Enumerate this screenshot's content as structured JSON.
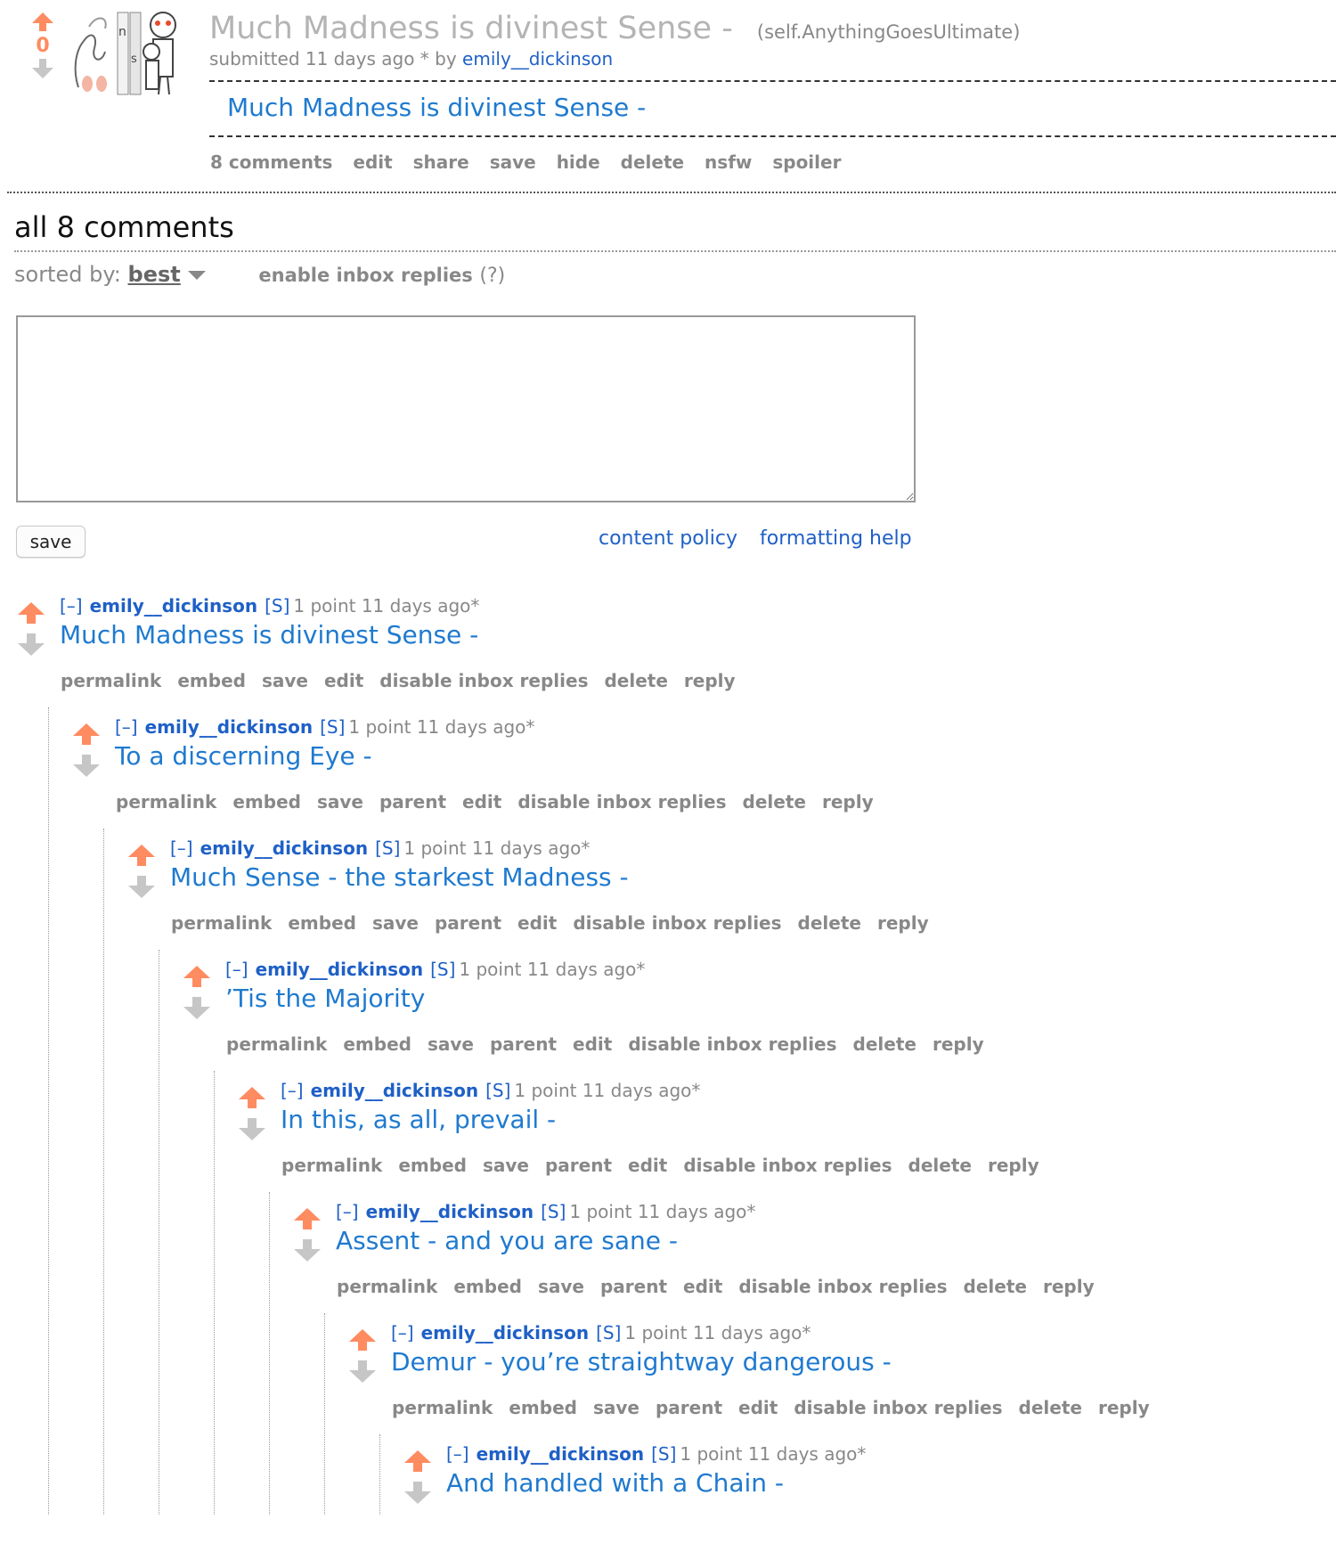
{
  "post": {
    "score": "0",
    "title": "Much Madness is divinest Sense -",
    "domain": "(self.AnythingGoesUltimate)",
    "submitted": "submitted 11 days ago * by",
    "author": "emily__dickinson",
    "selftext": "Much Madness is divinest Sense -",
    "buttons": [
      "8 comments",
      "edit",
      "share",
      "save",
      "hide",
      "delete",
      "nsfw",
      "spoiler"
    ]
  },
  "comments_area": {
    "heading": "all 8 comments",
    "sorted_by_label": "sorted by:",
    "sort_value": "best",
    "inbox_label": "enable inbox replies",
    "inbox_help": "(?)",
    "textarea_placeholder": "",
    "save_label": "save",
    "content_policy": "content policy",
    "formatting_help": "formatting help"
  },
  "comments": [
    {
      "toggle": "[–]",
      "author": "emily__dickinson",
      "submitter": "[S]",
      "meta": "1 point 11 days ago*",
      "body": "Much Madness is divinest Sense -",
      "buttons": [
        "permalink",
        "embed",
        "save",
        "edit",
        "disable inbox replies",
        "delete",
        "reply"
      ]
    },
    {
      "toggle": "[–]",
      "author": "emily__dickinson",
      "submitter": "[S]",
      "meta": "1 point 11 days ago*",
      "body": "To a discerning Eye -",
      "buttons": [
        "permalink",
        "embed",
        "save",
        "parent",
        "edit",
        "disable inbox replies",
        "delete",
        "reply"
      ]
    },
    {
      "toggle": "[–]",
      "author": "emily__dickinson",
      "submitter": "[S]",
      "meta": "1 point 11 days ago*",
      "body": "Much Sense - the starkest Madness -",
      "buttons": [
        "permalink",
        "embed",
        "save",
        "parent",
        "edit",
        "disable inbox replies",
        "delete",
        "reply"
      ]
    },
    {
      "toggle": "[–]",
      "author": "emily__dickinson",
      "submitter": "[S]",
      "meta": "1 point 11 days ago*",
      "body": "’Tis the Majority",
      "buttons": [
        "permalink",
        "embed",
        "save",
        "parent",
        "edit",
        "disable inbox replies",
        "delete",
        "reply"
      ]
    },
    {
      "toggle": "[–]",
      "author": "emily__dickinson",
      "submitter": "[S]",
      "meta": "1 point 11 days ago*",
      "body": "In this, as all, prevail -",
      "buttons": [
        "permalink",
        "embed",
        "save",
        "parent",
        "edit",
        "disable inbox replies",
        "delete",
        "reply"
      ]
    },
    {
      "toggle": "[–]",
      "author": "emily__dickinson",
      "submitter": "[S]",
      "meta": "1 point 11 days ago*",
      "body": "Assent - and you are sane -",
      "buttons": [
        "permalink",
        "embed",
        "save",
        "parent",
        "edit",
        "disable inbox replies",
        "delete",
        "reply"
      ]
    },
    {
      "toggle": "[–]",
      "author": "emily__dickinson",
      "submitter": "[S]",
      "meta": "1 point 11 days ago*",
      "body": "Demur - you’re straightway dangerous -",
      "buttons": [
        "permalink",
        "embed",
        "save",
        "parent",
        "edit",
        "disable inbox replies",
        "delete",
        "reply"
      ]
    },
    {
      "toggle": "[–]",
      "author": "emily__dickinson",
      "submitter": "[S]",
      "meta": "1 point 11 days ago*",
      "body": "And handled with a Chain -",
      "buttons": []
    }
  ],
  "colors": {
    "upvote": "#ff8b60",
    "downvote": "#c6c6c6",
    "link": "#1f60c7",
    "body_text": "#1f7acf",
    "muted": "#888888"
  }
}
